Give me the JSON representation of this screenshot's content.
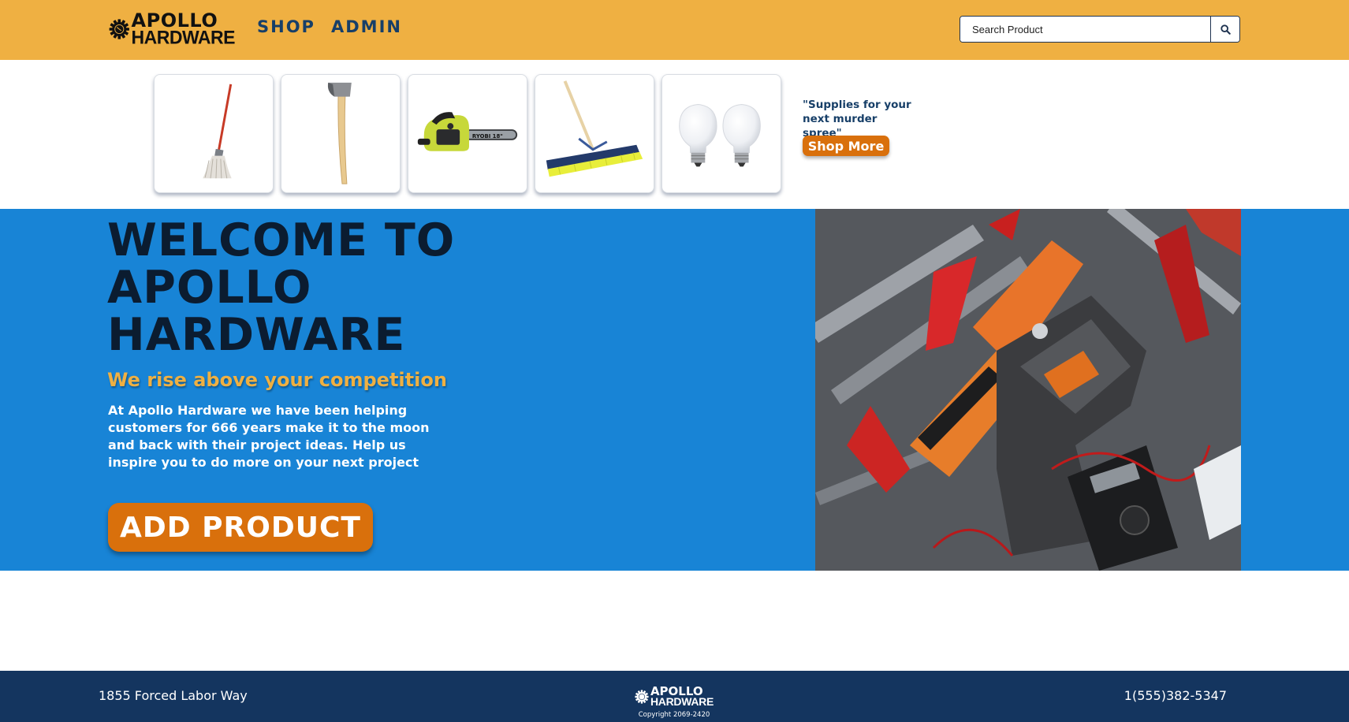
{
  "brand": {
    "line1": "APOLLO",
    "line2": "HARDWARE"
  },
  "nav": {
    "shop": "SHOP",
    "admin": "ADMIN"
  },
  "search": {
    "placeholder": "Search Product",
    "icon": "search-icon"
  },
  "products": [
    {
      "name": "mop-image"
    },
    {
      "name": "axe-image"
    },
    {
      "name": "chainsaw-image",
      "text": "RYOBI 18\""
    },
    {
      "name": "push-broom-image"
    },
    {
      "name": "light-bulbs-image"
    }
  ],
  "promo": {
    "quote": "\"Supplies for your next murder spree\"",
    "button": "Shop More"
  },
  "hero": {
    "title": "WELCOME TO APOLLO HARDWARE",
    "subtitle": "We rise above your competition",
    "body": "At Apollo Hardware we have been helping customers for 666 years make it to the moon and back with their project ideas. Help us inspire you to do more on your next project",
    "button": "ADD PRODUCT"
  },
  "footer": {
    "address": "1855 Forced Labor Way",
    "phone": "1(555)382-5347",
    "copyright": "Copyright 2069-2420"
  },
  "colors": {
    "nav_bg": "#efb042",
    "nav_link": "#173f68",
    "hero_bg": "#1884d6",
    "accent_orange": "#d9700c",
    "footer_bg": "#14355f"
  }
}
